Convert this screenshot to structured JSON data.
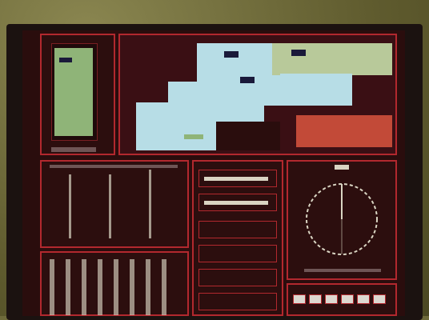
{
  "colors": {
    "screen_bg": "#2a0d0d",
    "border": "#b2282e",
    "map_light": "#b7dde6",
    "map_green": "#b8c99a",
    "map_dark": "#3a0f14",
    "map_red": "#c24a38",
    "gauge_green": "#8fb478",
    "text": "#e8e0d0"
  },
  "panels": {
    "left_gauge": {
      "label": ""
    },
    "map": {
      "label": ""
    },
    "trend": {
      "label": ""
    },
    "readouts": {
      "label": ""
    },
    "dial": {
      "label": ""
    },
    "button_strip": {
      "label": ""
    }
  },
  "icons": {
    "dial": "circular-dial-icon"
  }
}
